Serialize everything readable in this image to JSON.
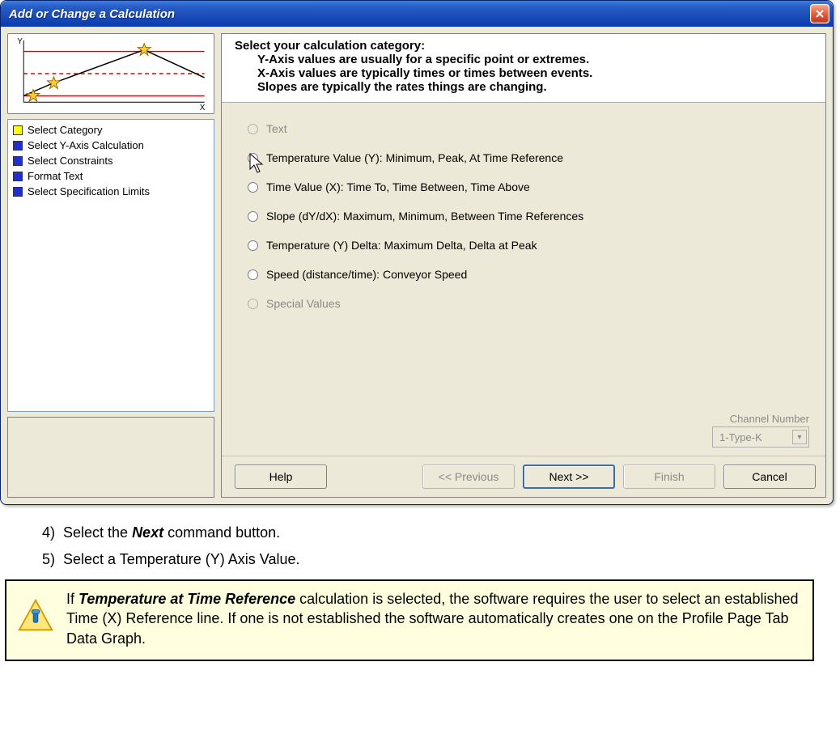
{
  "dialog": {
    "title": "Add or Change a Calculation",
    "close_aria": "Close",
    "steps": [
      {
        "label": "Select Category",
        "color": "yellow"
      },
      {
        "label": "Select Y-Axis Calculation",
        "color": "blue"
      },
      {
        "label": "Select Constraints",
        "color": "blue"
      },
      {
        "label": "Format Text",
        "color": "blue"
      },
      {
        "label": "Select Specification Limits",
        "color": "blue"
      }
    ],
    "header": {
      "line1": "Select your calculation category:",
      "line2": "Y-Axis values are usually for a specific point or extremes.",
      "line3": "X-Axis values are typically times or times between events.",
      "line4": "Slopes are typically the rates things are changing."
    },
    "options": [
      {
        "label": "Text",
        "enabled": false,
        "selected": false
      },
      {
        "label": "Temperature Value (Y):  Minimum, Peak, At Time Reference",
        "enabled": true,
        "selected": true
      },
      {
        "label": "Time Value (X):  Time To, Time Between, Time Above",
        "enabled": true,
        "selected": false
      },
      {
        "label": "Slope (dY/dX):  Maximum, Minimum, Between Time References",
        "enabled": true,
        "selected": false
      },
      {
        "label": "Temperature (Y) Delta:  Maximum Delta, Delta at Peak",
        "enabled": true,
        "selected": false
      },
      {
        "label": "Speed (distance/time): Conveyor Speed",
        "enabled": true,
        "selected": false
      },
      {
        "label": "Special  Values",
        "enabled": false,
        "selected": false
      }
    ],
    "channel": {
      "label": "Channel Number",
      "value": "1-Type-K",
      "enabled": false
    },
    "buttons": {
      "help": "Help",
      "previous": "<< Previous",
      "next": "Next >>",
      "finish": "Finish",
      "cancel": "Cancel"
    }
  },
  "instructions": {
    "step4_num": "4)",
    "step4_pre": "Select the ",
    "step4_bold": "Next",
    "step4_post": " command button.",
    "step5_num": "5)",
    "step5": "Select a Temperature (Y) Axis Value."
  },
  "tip": {
    "pre": "If ",
    "bold": "Temperature at Time Reference",
    "post": " calculation is selected, the software requires the user to select an established Time (X) Reference line. If one is not established the software automatically creates one on the Profile Page Tab Data Graph."
  }
}
